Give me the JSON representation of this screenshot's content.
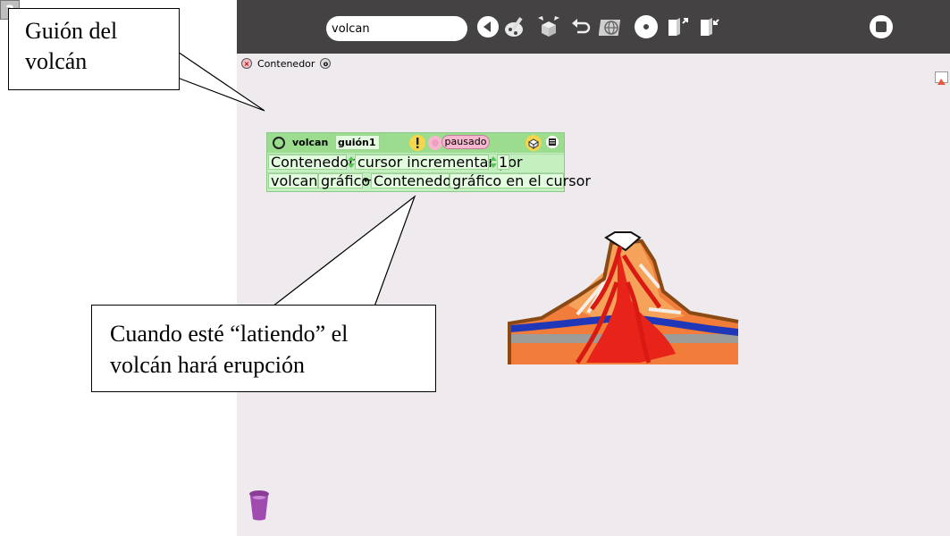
{
  "toolbar": {
    "help_label": "?",
    "project_name": "volcan",
    "icons": [
      "help-icon",
      "project-name-field",
      "back-arrow-icon",
      "paint-icon",
      "supplies-icon",
      "undo-icon",
      "globe-icon",
      "record-icon",
      "enlarge-icon",
      "shrink-icon",
      "stop-icon"
    ]
  },
  "flap": {
    "close_glyph": "×",
    "label": "Contenedor",
    "menu_glyph": "o"
  },
  "script": {
    "player_name": "volcan",
    "script_name": "guión1",
    "alert_glyph": "!",
    "status": "pausado",
    "row1": {
      "player": "Contenedor's",
      "command": "cursor incrementar por",
      "value": "1"
    },
    "row2": {
      "player": "volcan's",
      "slot": "gráfico",
      "arrow": "←",
      "source_player": "Contenedor's",
      "source_slot": "gráfico en el cursor"
    }
  },
  "callouts": {
    "top": {
      "line1": "Guión del",
      "line2": "volcán"
    },
    "bottom": {
      "line1": "Cuando esté “latiendo” el",
      "line2": "volcán hará erupción"
    }
  },
  "colors": {
    "toolbar_bg": "#444242",
    "world_bg": "#efeaee",
    "script_bg": "#c4f0c0",
    "script_header": "#9bdc8f",
    "status_pill": "#f7b7cf"
  }
}
